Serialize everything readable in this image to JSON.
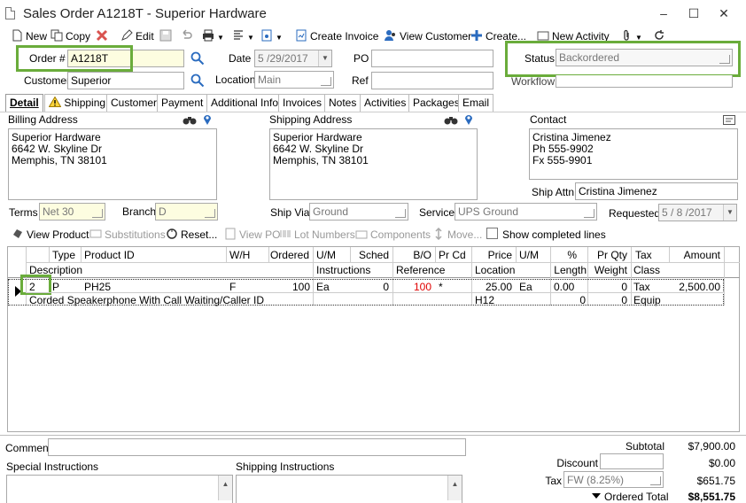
{
  "window": {
    "title": "Sales Order A1218T - Superior Hardware",
    "minimize": "–",
    "maximize": "☐",
    "close": "✕"
  },
  "toolbar": {
    "new": "New",
    "copy": "Copy",
    "edit": "Edit",
    "create_invoice": "Create Invoice",
    "view_customer": "View Customer",
    "create": "Create...",
    "new_activity": "New Activity"
  },
  "header": {
    "order_label": "Order #",
    "order_value": "A1218T",
    "date_label": "Date",
    "date_value": "5 /29/2017",
    "po_label": "PO",
    "po_value": "",
    "status_label": "Status",
    "status_value": "Backordered",
    "customer_label": "Customer",
    "customer_value": "Superior",
    "location_label": "Location",
    "location_value": "Main",
    "ref_label": "Ref",
    "ref_value": "",
    "workflow_label": "Workflow",
    "workflow_value": ""
  },
  "tabs": [
    "Detail",
    "Shipping",
    "Customer",
    "Payment",
    "Additional Info",
    "Invoices",
    "Notes",
    "Activities",
    "Packages",
    "Email"
  ],
  "billing": {
    "label": "Billing Address",
    "line1": "Superior Hardware",
    "line2": "6642 W. Skyline Dr",
    "line3": "Memphis, TN 38101"
  },
  "shipping": {
    "label": "Shipping Address",
    "line1": "Superior Hardware",
    "line2": "6642 W. Skyline Dr",
    "line3": "Memphis, TN 38101"
  },
  "contact": {
    "label": "Contact",
    "line1": "Cristina Jimenez",
    "line2": "Ph 555-9902",
    "line3": "Fx 555-9901",
    "ship_attn_label": "Ship Attn",
    "ship_attn_value": "Cristina Jimenez"
  },
  "terms": {
    "terms_label": "Terms",
    "terms_value": "Net 30",
    "branch_label": "Branch",
    "branch_value": "D",
    "ship_via_label": "Ship Via",
    "ship_via_value": "Ground",
    "service_label": "Service",
    "service_value": "UPS Ground",
    "requested_label": "Requested",
    "requested_value": "5 / 8 /2017"
  },
  "lines_toolbar": {
    "view_product": "View Product",
    "substitutions": "Substitutions",
    "reset": "Reset...",
    "view_po": "View PO",
    "lot_numbers": "Lot Numbers",
    "components": "Components",
    "move": "Move...",
    "show_completed": "Show completed lines"
  },
  "grid": {
    "head1": {
      "type": "Type",
      "product_id": "Product ID",
      "wh": "W/H",
      "ordered": "Ordered",
      "um": "U/M",
      "sched": "Sched",
      "bo": "B/O",
      "prcd": "Pr Cd",
      "price": "Price",
      "um2": "U/M",
      "pct": "%",
      "prqty": "Pr Qty",
      "tax": "Tax",
      "amount": "Amount"
    },
    "head2": {
      "description": "Description",
      "instructions": "Instructions",
      "reference": "Reference",
      "location": "Location",
      "length": "Length",
      "weight": "Weight",
      "class": "Class"
    },
    "row": {
      "num": "2",
      "type": "P",
      "product_id": "PH25",
      "wh": "F",
      "ordered": "100",
      "um": "Ea",
      "sched": "0",
      "bo": "100",
      "prcd": "*",
      "price": "25.00",
      "um2": "Ea",
      "pct": "0.00",
      "prqty": "0",
      "tax": "Tax",
      "amount": "2,500.00",
      "description": "Corded Speakerphone With Call Waiting/Caller ID",
      "location": "H12",
      "length": "0",
      "weight": "0",
      "class": "Equip"
    }
  },
  "footer": {
    "comment_label": "Comment",
    "special_label": "Special Instructions",
    "shipping_instr_label": "Shipping Instructions",
    "subtotal_label": "Subtotal",
    "subtotal_value": "$7,900.00",
    "discount_label": "Discount",
    "discount_value": "$0.00",
    "tax_label": "Tax",
    "tax_field": "FW (8.25%)",
    "tax_value": "$651.75",
    "ordered_total_label": "Ordered Total",
    "ordered_total_value": "$8,551.75"
  },
  "colors": {
    "highlight": "#6aac3b",
    "yellow_field": "#fdfde0",
    "bo_red": "#e00000"
  }
}
